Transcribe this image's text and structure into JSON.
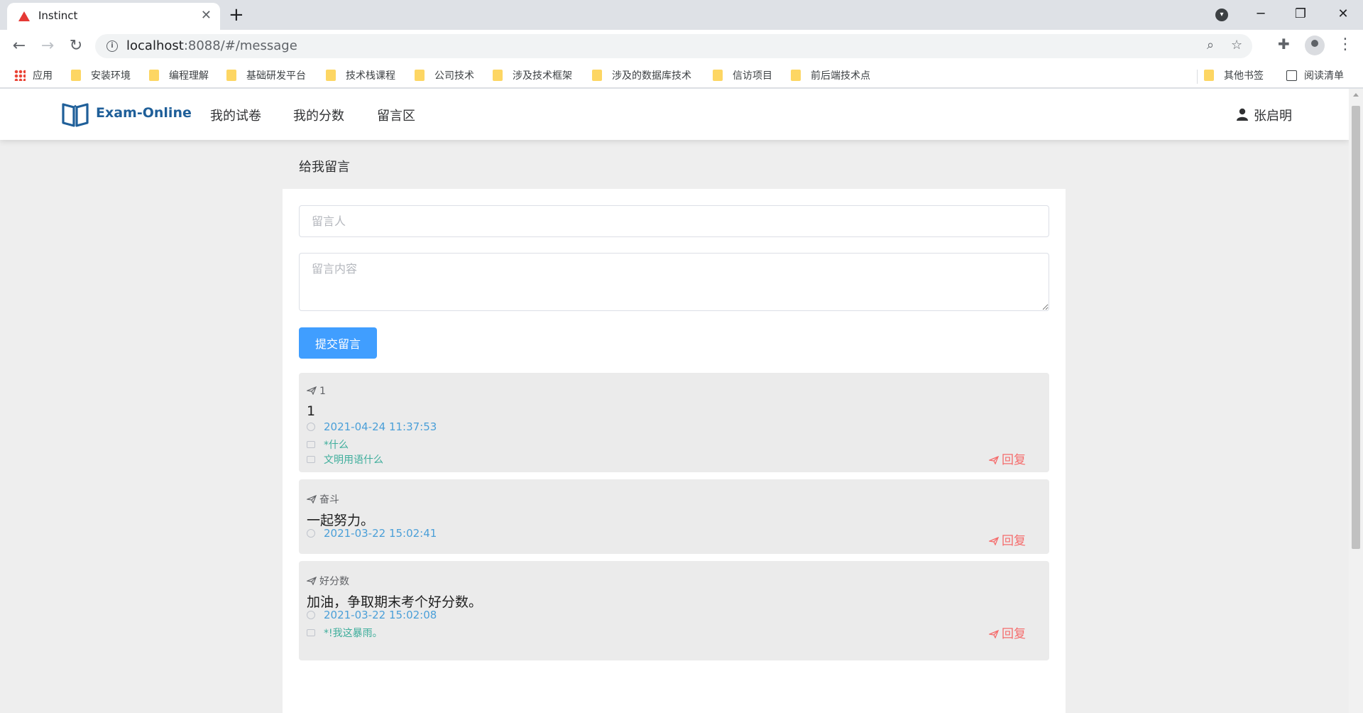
{
  "browser": {
    "tab_title": "Instinct",
    "url_host": "localhost",
    "url_rest": ":8088/#/message",
    "bookmarks": [
      {
        "label": "应用",
        "icon": "apps-grid-icon"
      },
      {
        "label": "安装环境",
        "icon": "folder-icon"
      },
      {
        "label": "编程理解",
        "icon": "folder-icon"
      },
      {
        "label": "基础研发平台",
        "icon": "folder-icon"
      },
      {
        "label": "技术栈课程",
        "icon": "folder-icon"
      },
      {
        "label": "公司技术",
        "icon": "folder-icon"
      },
      {
        "label": "涉及技术框架",
        "icon": "folder-icon"
      },
      {
        "label": "涉及的数据库技术",
        "icon": "folder-icon"
      },
      {
        "label": "信访项目",
        "icon": "folder-icon"
      },
      {
        "label": "前后端技术点",
        "icon": "folder-icon"
      }
    ],
    "other_bookmarks": "其他书签",
    "reading_list": "阅读清单"
  },
  "nav": {
    "brand": "Exam-Online",
    "items": [
      "我的试卷",
      "我的分数",
      "留言区"
    ],
    "user": "张启明"
  },
  "form": {
    "section_title": "给我留言",
    "author_placeholder": "留言人",
    "content_placeholder": "留言内容",
    "submit_label": "提交留言"
  },
  "messages": [
    {
      "title": "1",
      "content": "1",
      "time": "2021-04-24 11:37:53",
      "replies": [
        "*什么",
        "文明用语什么"
      ],
      "reply_label": "回复"
    },
    {
      "title": "奋斗",
      "content": "一起努力。",
      "time": "2021-03-22 15:02:41",
      "replies": [],
      "reply_label": "回复"
    },
    {
      "title": "好分数",
      "content": "加油，争取期末考个好分数。",
      "time": "2021-03-22 15:02:08",
      "replies": [
        "*!我这暴雨。"
      ],
      "reply_label": "回复"
    }
  ],
  "colors": {
    "primary": "#409eff",
    "brand": "#1f5f99",
    "time": "#4a9fd8",
    "reply_text": "#3fae9c",
    "reply_button": "#f56c6c"
  }
}
